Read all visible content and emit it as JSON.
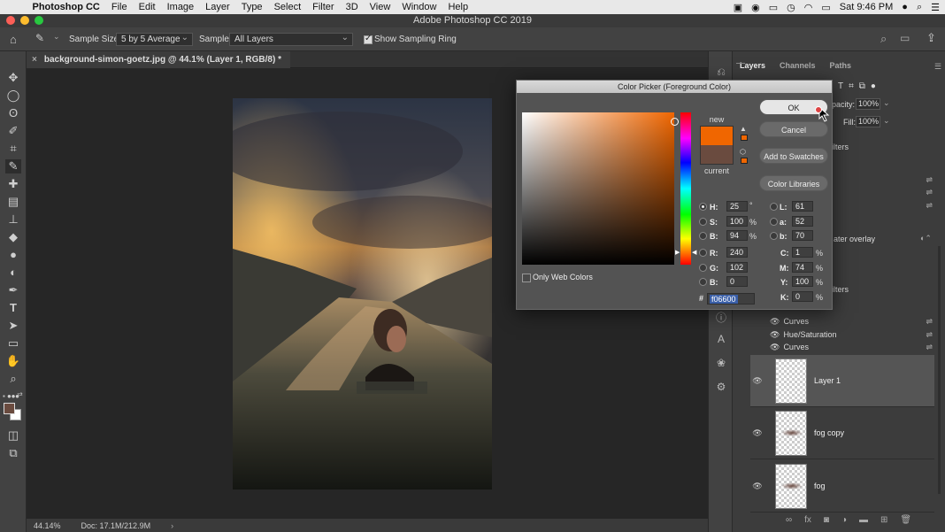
{
  "menubar": {
    "app_name": "Photoshop CC",
    "items": [
      "File",
      "Edit",
      "Image",
      "Layer",
      "Type",
      "Select",
      "Filter",
      "3D",
      "View",
      "Window",
      "Help"
    ],
    "clock": "Sat 9:46 PM"
  },
  "window": {
    "title": "Adobe Photoshop CC 2019"
  },
  "options": {
    "sample_size_label": "Sample Size:",
    "sample_size_value": "5 by 5 Average",
    "sample_label": "Sample:",
    "sample_value": "All Layers",
    "show_ring_label": "Show Sampling Ring",
    "show_ring_checked": true
  },
  "document_tab": {
    "title": "background-simon-goetz.jpg @ 44.1% (Layer 1, RGB/8) *"
  },
  "statusbar": {
    "zoom": "44.14%",
    "doc": "Doc: 17.1M/212.9M"
  },
  "layers_panel": {
    "tabs": [
      "Layers",
      "Channels",
      "Paths"
    ],
    "opacity_label": "pacity:",
    "opacity_value": "100%",
    "fill_label": "Fill:",
    "fill_value": "100%",
    "partial_labels": [
      "ilters",
      "ater overlay",
      "ilters"
    ],
    "adjustments": [
      "Curves",
      "Hue/Saturation",
      "Curves"
    ],
    "layers": [
      {
        "name": "Layer 1",
        "selected": true
      },
      {
        "name": "fog copy",
        "selected": false
      },
      {
        "name": "fog",
        "selected": false
      }
    ]
  },
  "color_picker": {
    "title": "Color Picker (Foreground Color)",
    "new_label": "new",
    "current_label": "current",
    "new_color": "#f06600",
    "current_color": "#6a4b3f",
    "buttons": {
      "ok": "OK",
      "cancel": "Cancel",
      "add_swatches": "Add to Swatches",
      "libraries": "Color Libraries"
    },
    "only_web_label": "Only Web Colors",
    "hsb": {
      "h": "25",
      "s": "100",
      "b": "94"
    },
    "rgb": {
      "r": "240",
      "g": "102",
      "b": "0"
    },
    "lab": {
      "l": "61",
      "a": "52",
      "b": "70"
    },
    "cmyk": {
      "c": "1",
      "m": "74",
      "y": "100",
      "k": "0"
    },
    "hex": "f06600",
    "labels": {
      "h": "H:",
      "s": "S:",
      "b": "B:",
      "r": "R:",
      "g": "G:",
      "b2": "B:",
      "l": "L:",
      "a": "a:",
      "b3": "b:",
      "c": "C:",
      "m": "M:",
      "y": "Y:",
      "k": "K:",
      "hash": "#"
    },
    "units": {
      "deg": "°",
      "pct": "%"
    }
  }
}
